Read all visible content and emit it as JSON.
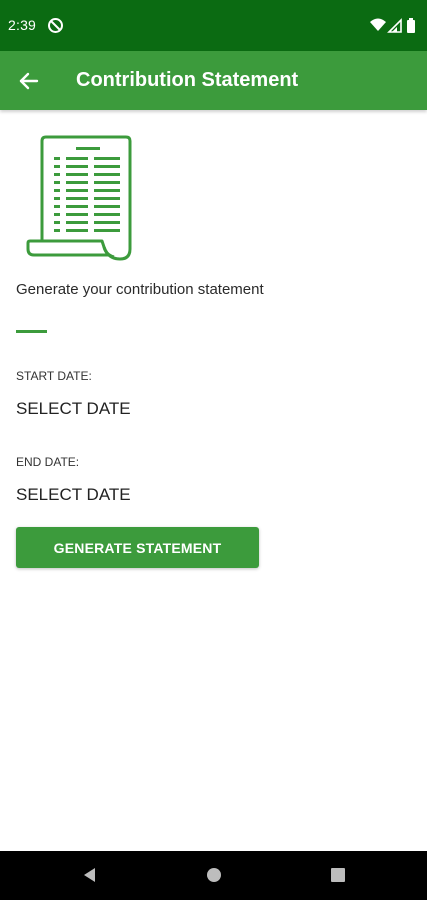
{
  "status_bar": {
    "time": "2:39",
    "icons": [
      "do-not-disturb-icon",
      "wifi-icon",
      "signal-icon",
      "battery-icon"
    ]
  },
  "app_bar": {
    "title": "Contribution Statement",
    "back_icon": "arrow-back-icon"
  },
  "content": {
    "illustration_icon": "document-statement-icon",
    "intro": "Generate your contribution statement",
    "start_date_label": "START DATE:",
    "start_date_value": "SELECT DATE",
    "end_date_label": "END DATE:",
    "end_date_value": "SELECT DATE",
    "generate_button": "GENERATE STATEMENT"
  },
  "nav_bar": {
    "icons": [
      "back-triangle-icon",
      "home-circle-icon",
      "recents-square-icon"
    ]
  },
  "colors": {
    "status_bar": "#0b6b12",
    "app_bar": "#3c9b3c",
    "accent": "#3c9b3c",
    "nav_bar": "#000000"
  }
}
